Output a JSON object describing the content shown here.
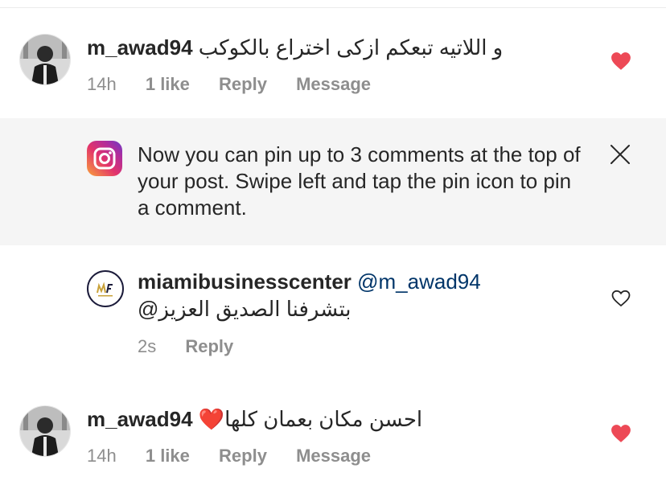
{
  "comments": [
    {
      "username": "m_awad94",
      "text": "و اللاتيه تبعكم ازكى اختراع بالكوكب",
      "time": "14h",
      "likes": "1 like",
      "reply": "Reply",
      "message": "Message",
      "liked": true
    },
    {
      "username": "m_awad94",
      "text": "احسن مكان بعمان كلها❤️",
      "time": "14h",
      "likes": "1 like",
      "reply": "Reply",
      "message": "Message",
      "liked": true
    }
  ],
  "banner": {
    "text": "Now you can pin up to 3 comments at the top of your post. Swipe left and tap the pin icon to pin a comment."
  },
  "reply_comment": {
    "username": "miamibusinesscenter",
    "mention": "@m_awad94",
    "text": "بتشرفنا الصديق العزيز@",
    "time": "2s",
    "reply": "Reply",
    "liked": false
  },
  "colors": {
    "heart_active": "#ed4956",
    "heart_outline": "#262626",
    "mention": "#003569",
    "meta_gray": "#8e8e8e",
    "banner_bg": "#f5f5f5"
  },
  "icons": {
    "banner_icon": "instagram-logo-icon",
    "close": "close-icon",
    "like_filled": "heart-filled-icon",
    "like_outline": "heart-outline-icon"
  }
}
